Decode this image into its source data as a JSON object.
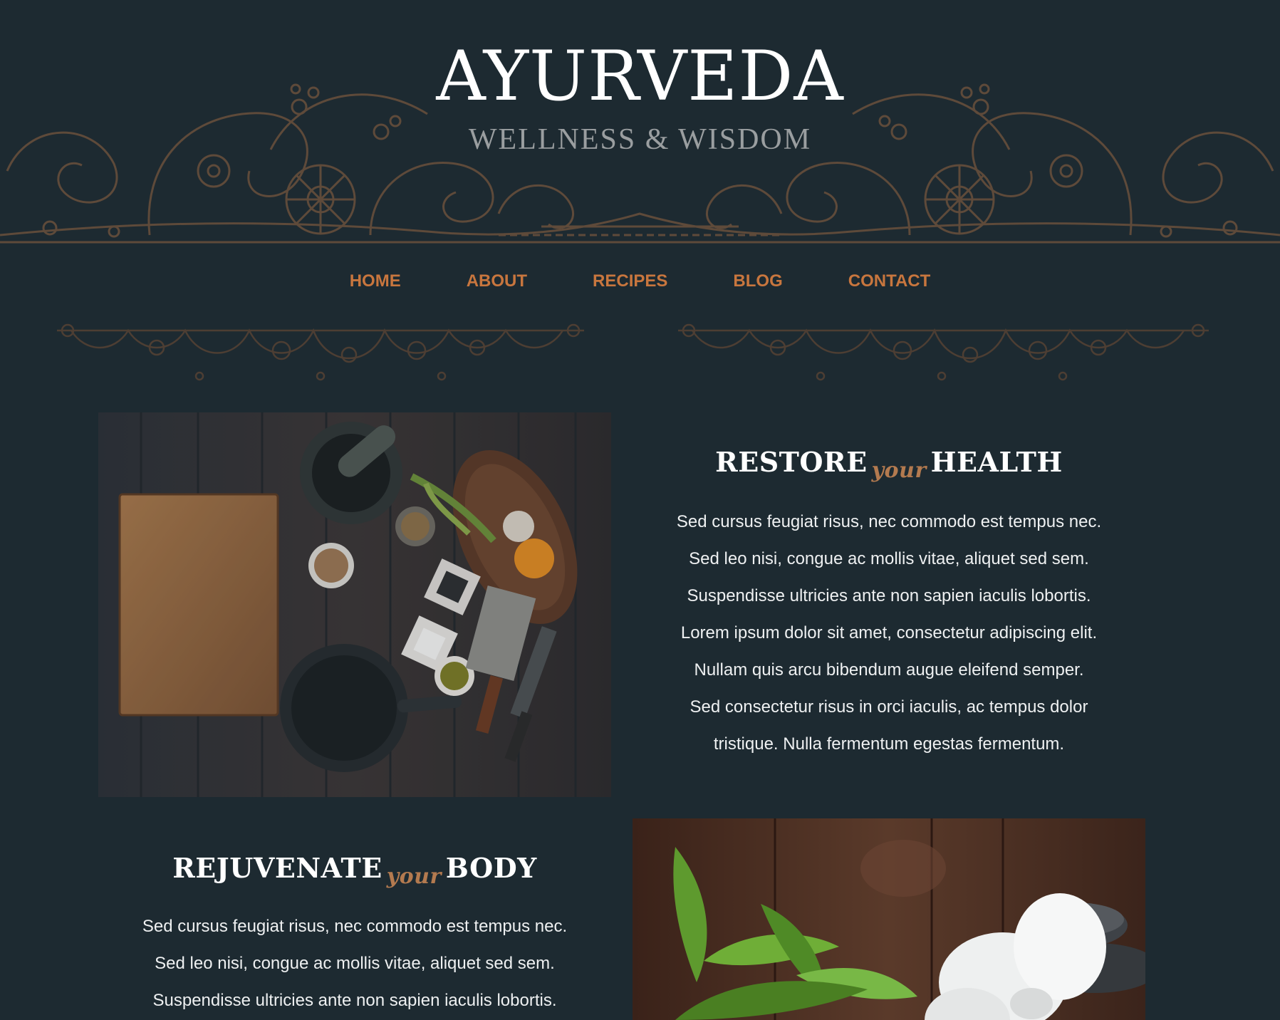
{
  "site": {
    "title": "AYURVEDA",
    "subtitle": "WELLNESS & WISDOM"
  },
  "nav": {
    "items": [
      {
        "label": "HOME"
      },
      {
        "label": "ABOUT"
      },
      {
        "label": "RECIPES"
      },
      {
        "label": "BLOG"
      },
      {
        "label": "CONTACT"
      }
    ]
  },
  "sections": [
    {
      "heading_before": "RESTORE",
      "heading_script": "your",
      "heading_after": "HEALTH",
      "lines": [
        "Sed cursus feugiat risus, nec commodo est tempus nec.",
        "Sed leo nisi, congue ac mollis vitae, aliquet sed sem.",
        "Suspendisse ultricies ante non sapien iaculis lobortis.",
        "Lorem ipsum dolor sit amet, consectetur adipiscing elit.",
        "Nullam quis arcu bibendum augue eleifend semper.",
        "Sed consectetur risus in orci iaculis, ac tempus dolor",
        "tristique. Nulla fermentum egestas fermentum."
      ]
    },
    {
      "heading_before": "REJUVENATE",
      "heading_script": "your",
      "heading_after": "BODY",
      "lines": [
        "Sed cursus feugiat risus, nec commodo est tempus nec.",
        "Sed leo nisi, congue ac mollis vitae, aliquet sed sem.",
        "Suspendisse ultricies ante non sapien iaculis lobortis."
      ]
    }
  ],
  "colors": {
    "background": "#1d2a31",
    "nav_link": "#c8763e",
    "ornament": "#5e4a3a",
    "script_accent": "#b37a4f"
  }
}
